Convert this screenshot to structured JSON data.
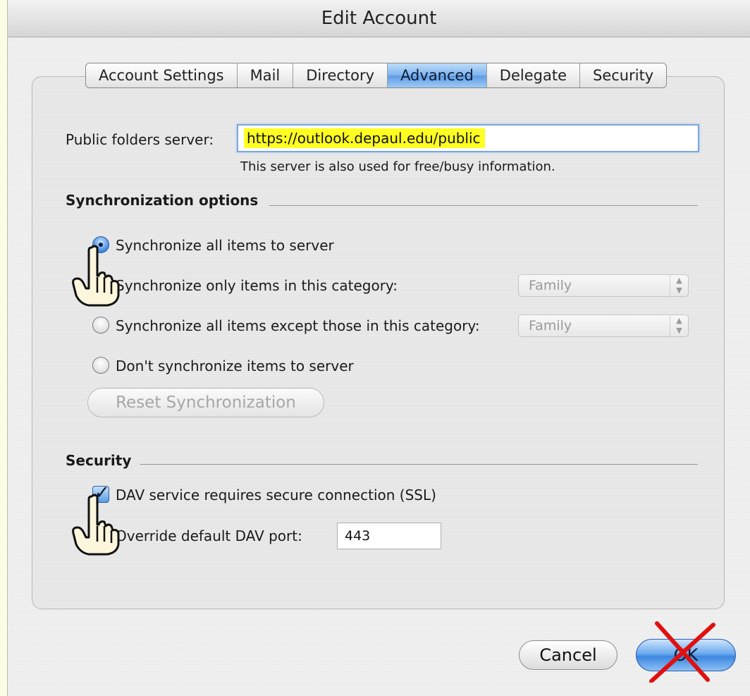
{
  "window": {
    "title": "Edit Account"
  },
  "tabs": [
    {
      "label": "Account Settings"
    },
    {
      "label": "Mail"
    },
    {
      "label": "Directory"
    },
    {
      "label": "Advanced",
      "active": true
    },
    {
      "label": "Delegate"
    },
    {
      "label": "Security"
    }
  ],
  "public_folders": {
    "label": "Public folders server:",
    "value": "https://outlook.depaul.edu/public",
    "hint": "This server is also used for free/busy information."
  },
  "sync": {
    "heading": "Synchronization options",
    "options": [
      {
        "label": "Synchronize all items to server",
        "selected": true
      },
      {
        "label": "Synchronize only items in this category:",
        "selected": false,
        "category": "Family"
      },
      {
        "label": "Synchronize all items except those in this category:",
        "selected": false,
        "category": "Family"
      },
      {
        "label": "Don't synchronize items to server",
        "selected": false
      }
    ],
    "reset_label": "Reset Synchronization"
  },
  "security": {
    "heading": "Security",
    "ssl_label": "DAV service requires secure connection (SSL)",
    "ssl_checked": true,
    "port_label": "Override default DAV port:",
    "port_value": "443"
  },
  "buttons": {
    "cancel": "Cancel",
    "ok": "OK"
  },
  "icons": {
    "pointer_hand": "pointing-hand-icon",
    "cross": "red-x-icon",
    "select_arrows": "up-down-arrows-icon"
  },
  "colors": {
    "highlight": "#ffff22",
    "accent": "#5e9be4",
    "cross": "#e01010"
  }
}
